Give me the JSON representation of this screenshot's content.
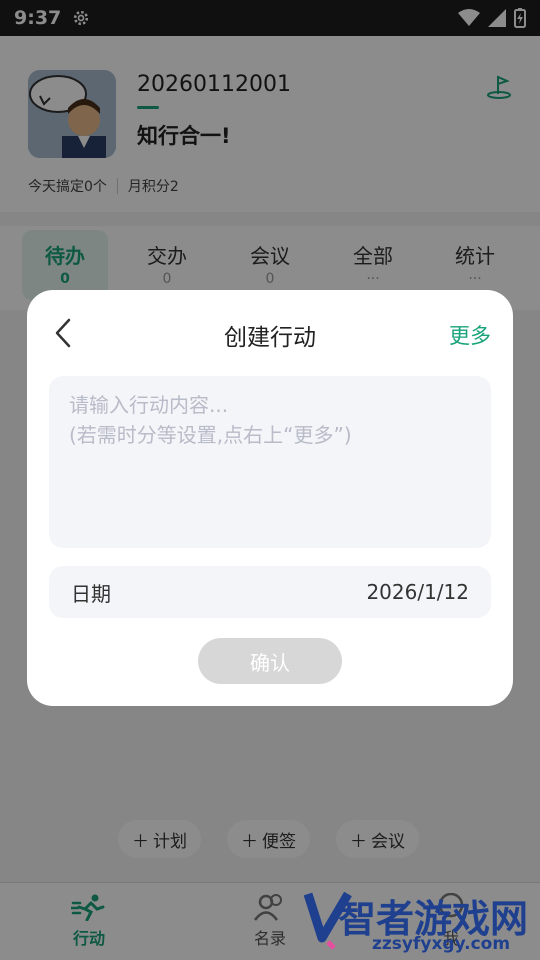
{
  "status_bar": {
    "time": "9:37"
  },
  "profile": {
    "user_id": "20260112001",
    "motto": "知行合一!",
    "today_done": "今天搞定0个",
    "month_score": "月积分2"
  },
  "tabs": [
    {
      "label": "待办",
      "count": "0",
      "active": true
    },
    {
      "label": "交办",
      "count": "0",
      "active": false
    },
    {
      "label": "会议",
      "count": "0",
      "active": false
    },
    {
      "label": "全部",
      "count": "···",
      "active": false
    },
    {
      "label": "统计",
      "count": "···",
      "active": false
    }
  ],
  "quick_actions": {
    "plan": "计划",
    "note": "便签",
    "meeting": "会议"
  },
  "bottom_nav": {
    "action": "行动",
    "contacts": "名录",
    "other": "我"
  },
  "watermark": {
    "name": "智者游戏网",
    "url": "zzsyfyxgy.com"
  },
  "dialog": {
    "title": "创建行动",
    "more": "更多",
    "content_placeholder": "请输入行动内容...\n(若需时分等设置,点右上“更多”)",
    "date_label": "日期",
    "date_value": "2026/1/12",
    "confirm": "确认"
  },
  "colors": {
    "accent": "#1aa37a",
    "confirm_disabled": "#d7d7d7",
    "watermark": "#1f3f8f"
  }
}
